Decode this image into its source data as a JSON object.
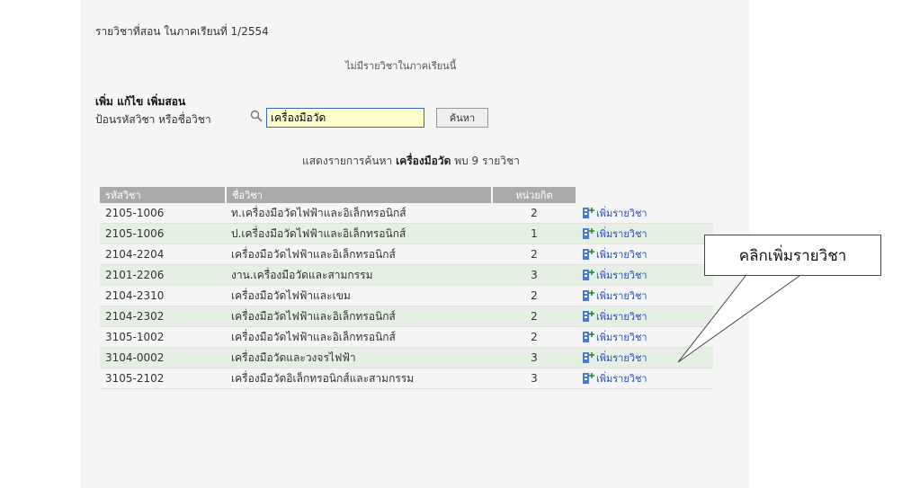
{
  "page": {
    "heading": "รายวิชาที่สอน ในภาคเรียนที่ 1/2554",
    "notice": "ไม่มีรายวิชาในภาคเรียนนี้"
  },
  "search": {
    "title": "เพิ่ม แก้ไข เพิ่มสอน",
    "label": "ป้อนรหัสวิชา หรือชื่อวิชา",
    "value": "เครื่องมือวัด",
    "button_label": "ค้นหา",
    "icon": "search-icon"
  },
  "result": {
    "prefix": "แสดงรายการค้นหา",
    "keyword": "เครื่องมือวัด",
    "suffix": "พบ 9 รายวิชา"
  },
  "table": {
    "headers": [
      "รหัสวิชา",
      "ชื่อวิชา",
      "หน่วยกิต"
    ],
    "action_label": "เพิ่มรายวิชา",
    "rows": [
      {
        "code": "2105-1006",
        "name": "ท.เครื่องมือวัดไฟฟ้าและอิเล็กทรอนิกส์",
        "credits": "2"
      },
      {
        "code": "2105-1006",
        "name": "ป.เครื่องมือวัดไฟฟ้าและอิเล็กทรอนิกส์",
        "credits": "1"
      },
      {
        "code": "2104-2204",
        "name": "เครื่องมือวัดไฟฟ้าและอิเล็กทรอนิกส์",
        "credits": "2"
      },
      {
        "code": "2101-2206",
        "name": "งาน.เครื่องมือวัดและสามกรรม",
        "credits": "3"
      },
      {
        "code": "2104-2310",
        "name": "เครื่องมือวัดไฟฟ้าและเขม",
        "credits": "2"
      },
      {
        "code": "2104-2302",
        "name": "เครื่องมือวัดไฟฟ้าและอิเล็กทรอนิกส์",
        "credits": "2"
      },
      {
        "code": "3105-1002",
        "name": "เครื่องมือวัดไฟฟ้าและอิเล็กทรอนิกส์",
        "credits": "2"
      },
      {
        "code": "3104-0002",
        "name": "เครื่องมือวัดและวงจรไฟฟ้า",
        "credits": "3"
      },
      {
        "code": "3105-2102",
        "name": "เครื่องมือวัดอิเล็กทรอนิกส์และสามกรรม",
        "credits": "3"
      }
    ]
  },
  "callout": {
    "text": "คลิกเพิ่มรายวิชา"
  },
  "colors": {
    "header_bg": "#aaaaaa",
    "alt_row_bg": "#e6efe4",
    "link": "#2a4db3",
    "input_bg": "#ffffcc"
  }
}
